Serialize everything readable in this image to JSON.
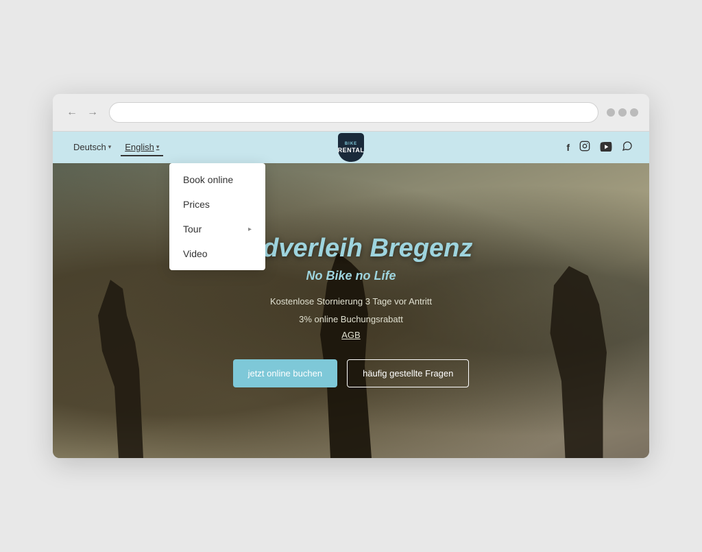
{
  "browser": {
    "back_label": "←",
    "forward_label": "→",
    "address_placeholder": ""
  },
  "nav": {
    "lang_deutsch": "Deutsch",
    "lang_english": "English",
    "logo_top": "BIKE",
    "logo_mid": "RENTAL",
    "logo_bot": "",
    "social": {
      "facebook": "f",
      "instagram": "📷",
      "youtube": "▶",
      "whatsapp": "✆"
    }
  },
  "dropdown": {
    "items": [
      {
        "label": "Book online",
        "has_arrow": false
      },
      {
        "label": "Prices",
        "has_arrow": false
      },
      {
        "label": "Tour",
        "has_arrow": true
      },
      {
        "label": "Video",
        "has_arrow": false
      }
    ]
  },
  "hero": {
    "title": "Radverleih Bregenz",
    "subtitle": "No Bike no Life",
    "line1": "Kostenlose Stornierung 3 Tage vor Antritt",
    "line2": "3% online Buchungsrabatt",
    "agb": "AGB",
    "btn_primary": "jetzt online buchen",
    "btn_secondary": "häufig gestellte Fragen"
  }
}
